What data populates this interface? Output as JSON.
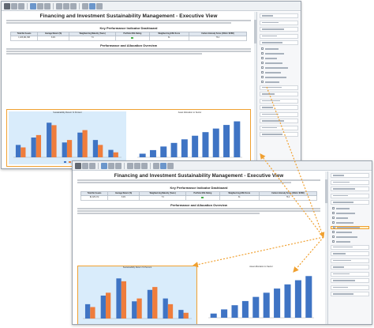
{
  "window_back": {
    "doc_title": "Financing and Investment Sustainability Management - Executive View",
    "kpi_title": "Key Performance Indicator Dashboard",
    "kpi_headers": [
      "Total Net Assets",
      "Average Return (%)",
      "Weighted Avg Maturity (Years)",
      "Portfolio ESG Rating",
      "Weighted Avg ESG Score",
      "Carbon Intensity Score (CO2e / $USD)"
    ],
    "kpi_values": [
      "1,325,281,358",
      "8.4%",
      "7.9",
      "",
      "61",
      "76.4"
    ],
    "overview_title": "Performance and Allocation Overview",
    "chart_left_title": "Sustainability Return % Percent",
    "chart_right_title": "Asset Allocation to Sector"
  },
  "window_front": {
    "doc_title": "Financing and Investment Sustainability Management - Executive View",
    "kpi_title": "Key Performance Indicator Dashboard",
    "kpi_headers": [
      "Total Net Assets",
      "Average Return (%)",
      "Weighted Avg Maturity (Years)",
      "Portfolio ESG Rating",
      "Weighted Avg ESG Score",
      "Carbon Intensity Score (CO2e / $USD)"
    ],
    "kpi_values": [
      "$1,325.2 M",
      "8.4%",
      "7.9",
      "",
      "61",
      "76.4"
    ],
    "overview_title": "Performance and Allocation Overview",
    "chart_left_title": "Sustainability Return % Percent",
    "chart_right_title": "Asset Allocation to Sector"
  },
  "chart_data": [
    {
      "type": "bar",
      "title": "Sustainability Return % Percent",
      "categories": [
        "",
        "",
        "",
        "",
        "",
        "",
        ""
      ],
      "series": [
        {
          "values": [
            5,
            8,
            14,
            6,
            10,
            7,
            3
          ]
        },
        {
          "values": [
            4,
            9,
            13,
            7,
            11,
            5,
            2
          ]
        }
      ],
      "ylim": [
        0,
        16
      ],
      "colors": [
        "#3f74c4",
        "#ef7d3c"
      ]
    },
    {
      "type": "bar",
      "title": "Asset Allocation to Sector",
      "categories": [
        "",
        "",
        "",
        "",
        "",
        "",
        "",
        "",
        "",
        ""
      ],
      "values": [
        2,
        4,
        6,
        8,
        10,
        12,
        14,
        16,
        18,
        20
      ],
      "ylim": [
        0,
        22
      ],
      "colors": [
        "#3f74c4"
      ]
    }
  ],
  "colors": {
    "highlight": "#f0a030",
    "bar_blue": "#3f74c4",
    "bar_orange": "#ef7d3c",
    "chart_bg": "#d9ecfb",
    "esg_green": "#49b049"
  }
}
